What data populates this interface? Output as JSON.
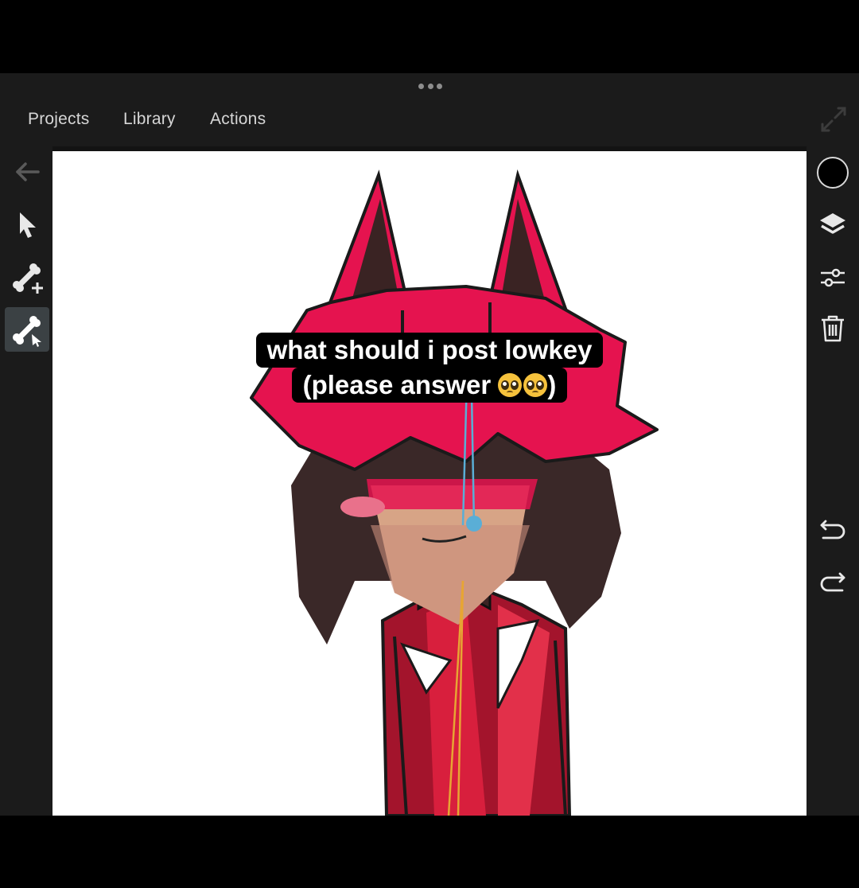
{
  "window": {
    "dots_icon": "more-dots-icon"
  },
  "menu": {
    "tabs": [
      {
        "label": "Projects"
      },
      {
        "label": "Library"
      },
      {
        "label": "Actions"
      }
    ]
  },
  "left_toolbar": {
    "items": [
      {
        "icon": "back-arrow-icon"
      },
      {
        "icon": "select-arrow-icon"
      },
      {
        "icon": "add-bone-icon"
      },
      {
        "icon": "bone-edit-icon",
        "active": true
      }
    ]
  },
  "right_toolbar": {
    "items": [
      {
        "icon": "color-swatch-icon",
        "color": "#000000"
      },
      {
        "icon": "layers-icon"
      },
      {
        "icon": "sliders-icon"
      },
      {
        "icon": "trash-icon"
      },
      {
        "icon": "undo-icon"
      },
      {
        "icon": "redo-icon"
      }
    ]
  },
  "caption": {
    "line1": "what should i post lowkey",
    "line2": "(please answer ",
    "line2_end": ")",
    "emoji": "pleading-face-icon"
  },
  "colors": {
    "app_bg": "#1b1b1b",
    "accent_active": "#3b4144",
    "hair": "#e5134f",
    "bone_blue": "#5aaed6",
    "bone_orange": "#e7a533"
  }
}
